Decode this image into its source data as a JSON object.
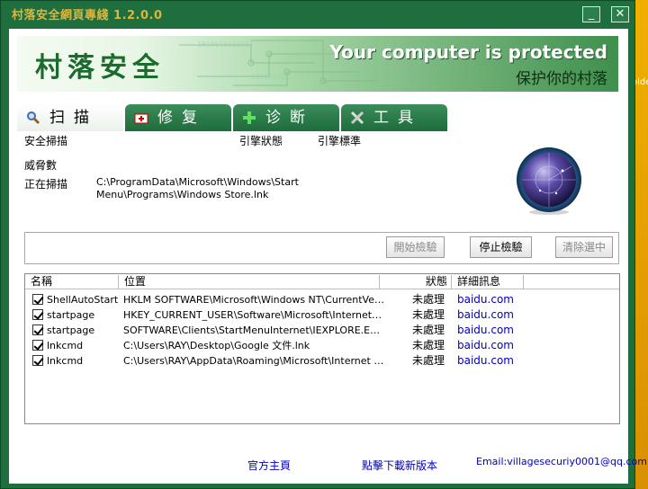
{
  "window": {
    "title": "村落安全網頁專綫 1.2.0.0",
    "minimize": "_",
    "close": "✕"
  },
  "desktop": {
    "label": "olde"
  },
  "banner": {
    "logo": "村落安全",
    "tagline_en": "Your computer is protected",
    "tagline_cn": "保护你的村落"
  },
  "tabs": [
    {
      "label": "扫描",
      "icon": "magnifier-icon"
    },
    {
      "label": "修复",
      "icon": "medkit-icon"
    },
    {
      "label": "诊断",
      "icon": "plus-icon"
    },
    {
      "label": "工具",
      "icon": "tools-icon"
    }
  ],
  "scan": {
    "type_label": "安全掃描",
    "engine_status": "引擎狀態",
    "engine_standard": "引擎標準",
    "threats_label": "威脅數",
    "scanning_label": "正在掃描",
    "scanning_path": "C:\\ProgramData\\Microsoft\\Windows\\Start Menu\\Programs\\Windows Store.lnk"
  },
  "buttons": {
    "start": "開始檢驗",
    "stop": "停止檢驗",
    "clear": "清除選中"
  },
  "table": {
    "headers": [
      "名稱",
      "位置",
      "狀態",
      "詳細訊息"
    ],
    "rows": [
      {
        "name": "ShellAutoStart",
        "location": "HKLM SOFTWARE\\Microsoft\\Windows NT\\CurrentVersio...",
        "status": "未處理",
        "detail": "baidu.com"
      },
      {
        "name": "startpage",
        "location": "HKEY_CURRENT_USER\\Software\\Microsoft\\Internet Ex...",
        "status": "未處理",
        "detail": "baidu.com"
      },
      {
        "name": "startpage",
        "location": "SOFTWARE\\Clients\\StartMenuInternet\\IEXPLORE.EXE\\...",
        "status": "未處理",
        "detail": "baidu.com"
      },
      {
        "name": "lnkcmd",
        "location": "C:\\Users\\RAY\\Desktop\\Google 文件.lnk",
        "status": "未處理",
        "detail": "baidu.com"
      },
      {
        "name": "lnkcmd",
        "location": "C:\\Users\\RAY\\AppData\\Roaming\\Microsoft\\Internet Ex...",
        "status": "未處理",
        "detail": "baidu.com"
      }
    ]
  },
  "footer": {
    "homepage": "官方主頁",
    "download": "點擊下載新版本",
    "email": "Email:villagesecuriy0001@qq.com"
  },
  "colors": {
    "frame": "#1f6e3e",
    "title": "#d9b640",
    "link": "#0000c0"
  }
}
